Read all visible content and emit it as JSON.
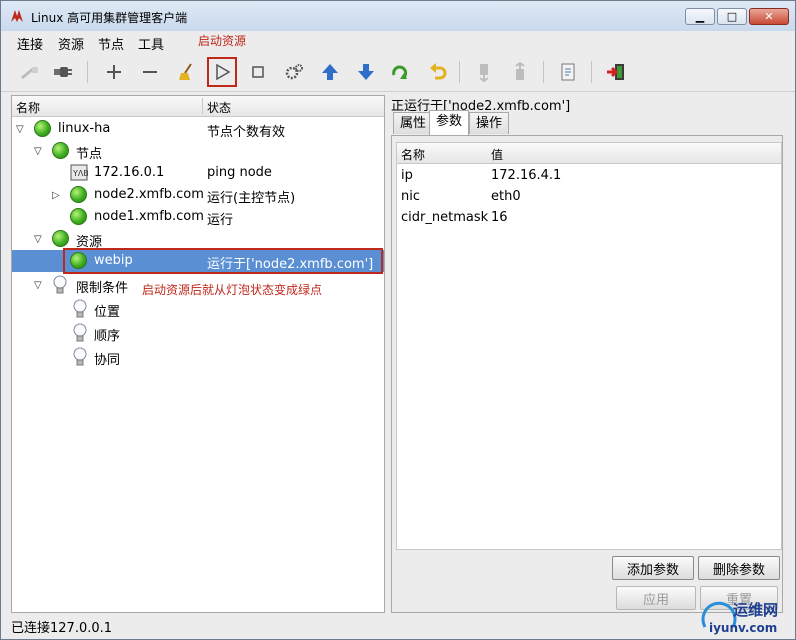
{
  "window": {
    "title": "Linux 高可用集群管理客户端"
  },
  "menu": {
    "items": [
      "连接",
      "资源",
      "节点",
      "工具"
    ]
  },
  "annotations": {
    "toolbar_note": "启动资源",
    "tree_note": "启动资源后就从灯泡状态变成绿点"
  },
  "toolbar": {
    "icons": [
      "disconnect-icon",
      "connect-icon",
      "add-icon",
      "remove-icon",
      "cleanup-broom-icon",
      "start-resource-icon",
      "stop-resource-icon",
      "settings-gears-icon",
      "move-up-icon",
      "move-down-icon",
      "refresh-icon",
      "undo-icon",
      "standby-node-icon",
      "active-node-icon",
      "view-xml-icon",
      "exit-icon"
    ]
  },
  "tree": {
    "columns": {
      "name": "名称",
      "state": "状态"
    },
    "rows": [
      {
        "label": "linux-ha",
        "state": "节点个数有效"
      },
      {
        "label": "节点",
        "state": ""
      },
      {
        "label": "172.16.0.1",
        "state": "ping node"
      },
      {
        "label": "node2.xmfb.com",
        "state": "运行(主控节点)"
      },
      {
        "label": "node1.xmfb.com",
        "state": "运行"
      },
      {
        "label": "资源",
        "state": ""
      },
      {
        "label": "webip",
        "state": "运行于['node2.xmfb.com']"
      },
      {
        "label": "限制条件",
        "state": ""
      },
      {
        "label": "位置",
        "state": ""
      },
      {
        "label": "顺序",
        "state": ""
      },
      {
        "label": "协同",
        "state": ""
      }
    ]
  },
  "detail": {
    "running_on": "正运行于['node2.xmfb.com']",
    "tabs": [
      "属性",
      "参数",
      "操作"
    ],
    "active_tab": "参数",
    "columns": {
      "name": "名称",
      "value": "值"
    },
    "params": [
      {
        "name": "ip",
        "value": "172.16.4.1"
      },
      {
        "name": "nic",
        "value": "eth0"
      },
      {
        "name": "cidr_netmask",
        "value": "16"
      }
    ],
    "buttons": {
      "add": "添加参数",
      "delete": "删除参数",
      "apply": "应用",
      "reset": "重置"
    }
  },
  "status": {
    "text": "已连接127.0.0.1"
  },
  "watermark": {
    "text": "运维网",
    "url_text": "iyunv.com"
  },
  "colors": {
    "selected_row": "#5b8fd3",
    "annotation_red": "#c0281c",
    "bulb_green": "#3fae20"
  }
}
